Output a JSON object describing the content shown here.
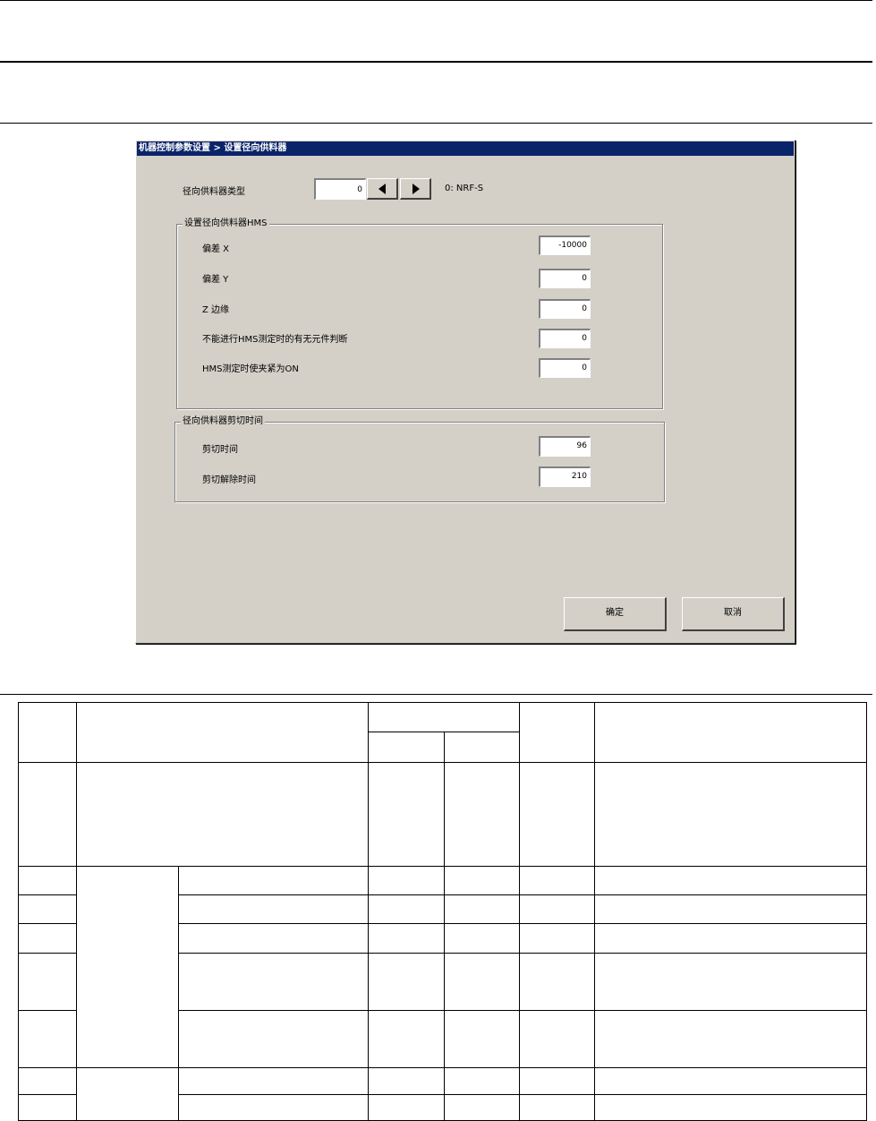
{
  "dialog": {
    "title": "机器控制参数设置 > 设置径向供料器",
    "feeder_type": {
      "label": "径向供料器类型",
      "value": "0",
      "description": "0: NRF-S"
    },
    "hms_group": {
      "title": "设置径向供料器HMS",
      "fields": [
        {
          "label": "偏差 X",
          "value": "-10000"
        },
        {
          "label": "偏差 Y",
          "value": "0"
        },
        {
          "label": "Z 边缘",
          "value": "0"
        },
        {
          "label": "不能进行HMS测定时的有无元件判断",
          "value": "0"
        },
        {
          "label": "HMS测定时使夹紧为ON",
          "value": "0"
        }
      ]
    },
    "cut_group": {
      "title": "径向供料器剪切时间",
      "fields": [
        {
          "label": "剪切时间",
          "value": "96"
        },
        {
          "label": "剪切解除时间",
          "value": "210"
        }
      ]
    },
    "buttons": {
      "ok": "确定",
      "cancel": "取消"
    }
  },
  "colors": {
    "dialog_face": "#d4d0c8",
    "titlebar": "#0a246a",
    "field_bg": "#ffffff"
  }
}
